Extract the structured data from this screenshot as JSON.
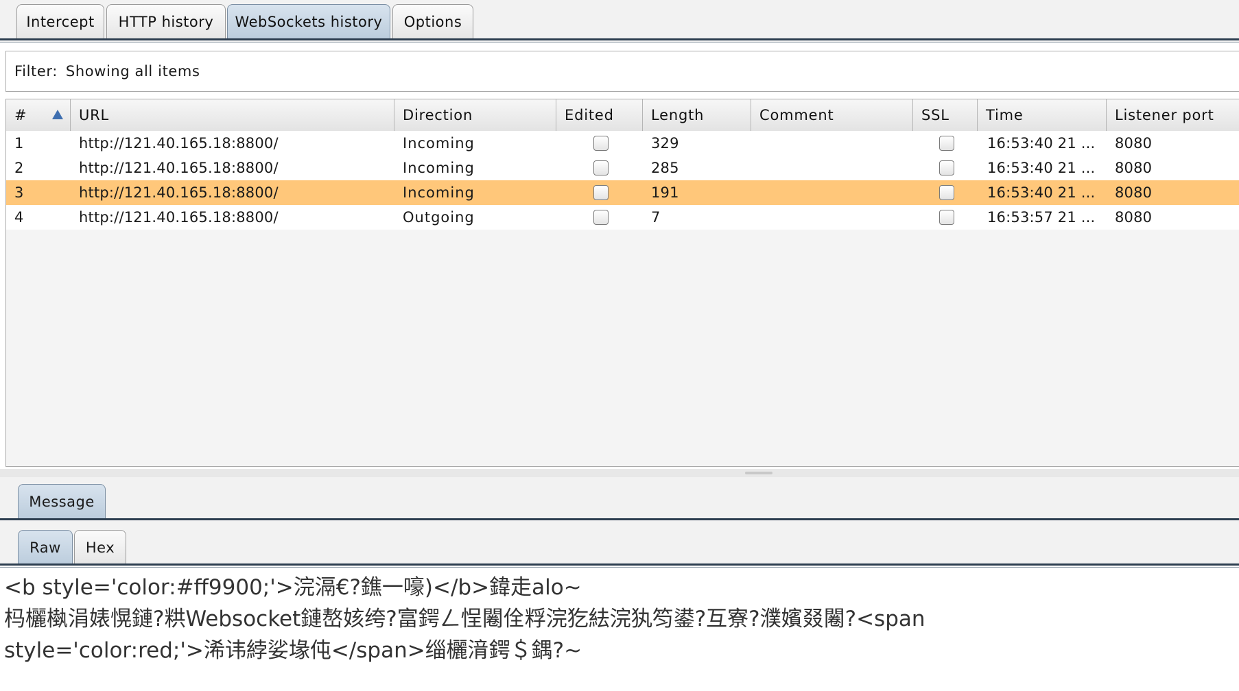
{
  "tabs": [
    {
      "label": "Intercept"
    },
    {
      "label": "HTTP history"
    },
    {
      "label": "WebSockets history",
      "active": true
    },
    {
      "label": "Options"
    }
  ],
  "filter": {
    "label": "Filter:",
    "value": "Showing all items"
  },
  "table": {
    "columns": [
      "#",
      "URL",
      "Direction",
      "Edited",
      "Length",
      "Comment",
      "SSL",
      "Time",
      "Listener port"
    ],
    "sort_icon": "sort-ascending-icon",
    "rows": [
      {
        "num": "1",
        "url": "http://121.40.165.18:8800/",
        "direction": "Incoming",
        "edited": false,
        "length": "329",
        "comment": "",
        "ssl": false,
        "time": "16:53:40 21 ...",
        "port": "8080",
        "selected": false
      },
      {
        "num": "2",
        "url": "http://121.40.165.18:8800/",
        "direction": "Incoming",
        "edited": false,
        "length": "285",
        "comment": "",
        "ssl": false,
        "time": "16:53:40 21 ...",
        "port": "8080",
        "selected": false
      },
      {
        "num": "3",
        "url": "http://121.40.165.18:8800/",
        "direction": "Incoming",
        "edited": false,
        "length": "191",
        "comment": "",
        "ssl": false,
        "time": "16:53:40 21 ...",
        "port": "8080",
        "selected": true
      },
      {
        "num": "4",
        "url": "http://121.40.165.18:8800/",
        "direction": "Outgoing",
        "edited": false,
        "length": "7",
        "comment": "",
        "ssl": false,
        "time": "16:53:57 21 ...",
        "port": "8080",
        "selected": false
      }
    ]
  },
  "message_tab": {
    "label": "Message"
  },
  "view_tabs": [
    {
      "label": "Raw",
      "active": true
    },
    {
      "label": "Hex"
    }
  ],
  "raw_content": "<b style='color:#ff9900;'>浣滆€?鐎一嚎)</b>鍏走alo~\n杩欐槸涓婊愰鏈?粠Websocket鏈嶅姟绔?富鍔ㄥ悜闂佺粰浣犵紶浣犱笉鍙?互寮?濮嬪叕闂?<span\nstyle='color:red;'>浠讳綍娑堟伅</span>缁欐湇鍔＄鍝?~",
  "colors": {
    "selected_row": "#ffc77a",
    "active_tab": "#bccddd",
    "tab_underline": "#2d3e50",
    "sort_icon": "#3f6fb0"
  }
}
